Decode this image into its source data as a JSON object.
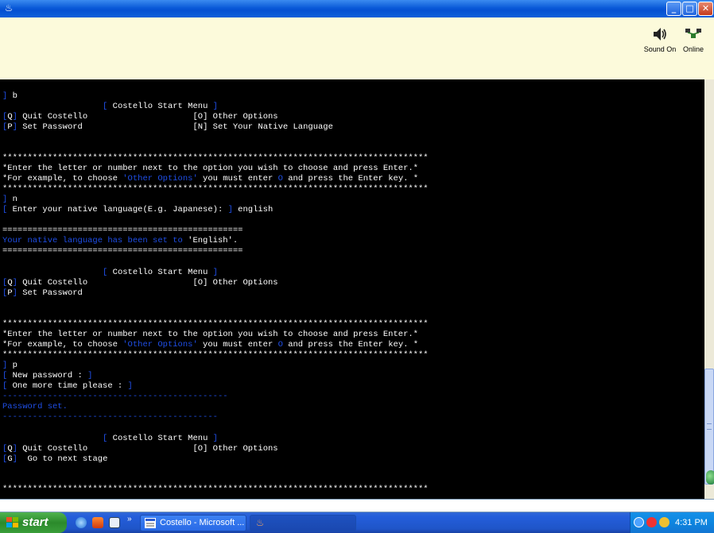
{
  "window": {
    "title": "",
    "buttons": {
      "minimize": "_",
      "maximize": "□",
      "close": "✕"
    },
    "app_icon": "java-cup-icon"
  },
  "status": {
    "sound": {
      "label": "Sound On",
      "icon": "speaker-icon"
    },
    "online": {
      "label": "Online",
      "icon": "network-icon"
    }
  },
  "console": {
    "lines": [
      [
        "] b"
      ],
      [
        "                    [ Costello Start Menu ]"
      ],
      [
        "[Q] Quit Costello                     [O] Other Options"
      ],
      [
        "[P] Set Password                      [N] Set Your Native Language"
      ],
      [
        ""
      ],
      [
        ""
      ],
      [
        "*************************************************************************************"
      ],
      [
        "*Enter the letter or number next to the option you wish to choose and press Enter.*"
      ],
      [
        "*For example, to choose 'Other Options' you must enter O and press the Enter key. *"
      ],
      [
        "*************************************************************************************"
      ],
      [
        "] n"
      ],
      [
        "[ Enter your native language(E.g. Japanese): ] english"
      ],
      [
        ""
      ],
      [
        "================================================"
      ],
      [
        "Your native language has been set to 'English'."
      ],
      [
        "================================================"
      ],
      [
        ""
      ],
      [
        "                    [ Costello Start Menu ]"
      ],
      [
        "[Q] Quit Costello                     [O] Other Options"
      ],
      [
        "[P] Set Password"
      ],
      [
        ""
      ],
      [
        ""
      ],
      [
        "*************************************************************************************"
      ],
      [
        "*Enter the letter or number next to the option you wish to choose and press Enter.*"
      ],
      [
        "*For example, to choose 'Other Options' you must enter O and press the Enter key. *"
      ],
      [
        "*************************************************************************************"
      ],
      [
        "] p"
      ],
      [
        "[ New password : ]"
      ],
      [
        "[ One more time please : ]"
      ],
      [
        "---------------------------------------------"
      ],
      [
        "Password set."
      ],
      [
        "-------------------------------------------"
      ],
      [
        ""
      ],
      [
        "                    [ Costello Start Menu ]"
      ],
      [
        "[Q] Quit Costello                     [O] Other Options"
      ],
      [
        "[G] Go to next stage"
      ],
      [
        ""
      ],
      [
        ""
      ],
      [
        "*************************************************************************************"
      ]
    ]
  },
  "taskbar": {
    "start_label": "start",
    "quick_launch_more": "»",
    "tasks": [
      {
        "label": "Costello - Microsoft ...",
        "icon": "word-doc-icon"
      },
      {
        "label": "",
        "icon": "java-cup-icon"
      }
    ],
    "clock": "4:31 PM"
  }
}
